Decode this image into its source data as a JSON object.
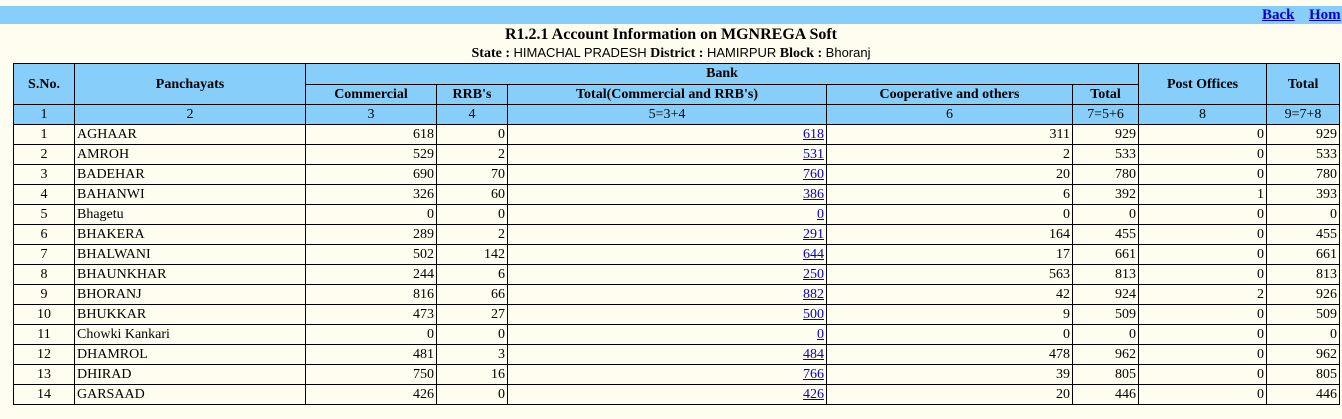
{
  "nav": {
    "back_label": "Back",
    "home_label": "Hom"
  },
  "report": {
    "title": "R1.2.1 Account Information on MGNREGA Soft",
    "state_label": "State :",
    "state_value": "HIMACHAL PRADESH",
    "district_label": "District :",
    "district_value": "HAMIRPUR",
    "block_label": "Block :",
    "block_value": "Bhoranj"
  },
  "headers": {
    "sno": "S.No.",
    "panchayats": "Panchayats",
    "bank": "Bank",
    "commercial": "Commercial",
    "rrb": "RRB's",
    "total_comm_rrb": "Total(Commercial and RRB's)",
    "cooperative": "Cooperative and others",
    "bank_total": "Total",
    "post_offices": "Post Offices",
    "total": "Total"
  },
  "column_numbers": [
    "1",
    "2",
    "3",
    "4",
    "5=3+4",
    "6",
    "7=5+6",
    "8",
    "9=7+8"
  ],
  "rows": [
    {
      "sno": "1",
      "name": "AGHAAR",
      "commercial": "618",
      "rrb": "0",
      "total_cr": "618",
      "coop": "311",
      "bank_total": "929",
      "post": "0",
      "total": "929"
    },
    {
      "sno": "2",
      "name": "AMROH",
      "commercial": "529",
      "rrb": "2",
      "total_cr": "531",
      "coop": "2",
      "bank_total": "533",
      "post": "0",
      "total": "533"
    },
    {
      "sno": "3",
      "name": "BADEHAR",
      "commercial": "690",
      "rrb": "70",
      "total_cr": "760",
      "coop": "20",
      "bank_total": "780",
      "post": "0",
      "total": "780"
    },
    {
      "sno": "4",
      "name": "BAHANWI",
      "commercial": "326",
      "rrb": "60",
      "total_cr": "386",
      "coop": "6",
      "bank_total": "392",
      "post": "1",
      "total": "393"
    },
    {
      "sno": "5",
      "name": "Bhagetu",
      "commercial": "0",
      "rrb": "0",
      "total_cr": "0",
      "coop": "0",
      "bank_total": "0",
      "post": "0",
      "total": "0"
    },
    {
      "sno": "6",
      "name": "BHAKERA",
      "commercial": "289",
      "rrb": "2",
      "total_cr": "291",
      "coop": "164",
      "bank_total": "455",
      "post": "0",
      "total": "455"
    },
    {
      "sno": "7",
      "name": "BHALWANI",
      "commercial": "502",
      "rrb": "142",
      "total_cr": "644",
      "coop": "17",
      "bank_total": "661",
      "post": "0",
      "total": "661"
    },
    {
      "sno": "8",
      "name": "BHAUNKHAR",
      "commercial": "244",
      "rrb": "6",
      "total_cr": "250",
      "coop": "563",
      "bank_total": "813",
      "post": "0",
      "total": "813"
    },
    {
      "sno": "9",
      "name": "BHORANJ",
      "commercial": "816",
      "rrb": "66",
      "total_cr": "882",
      "coop": "42",
      "bank_total": "924",
      "post": "2",
      "total": "926"
    },
    {
      "sno": "10",
      "name": "BHUKKAR",
      "commercial": "473",
      "rrb": "27",
      "total_cr": "500",
      "coop": "9",
      "bank_total": "509",
      "post": "0",
      "total": "509"
    },
    {
      "sno": "11",
      "name": "Chowki Kankari",
      "commercial": "0",
      "rrb": "0",
      "total_cr": "0",
      "coop": "0",
      "bank_total": "0",
      "post": "0",
      "total": "0"
    },
    {
      "sno": "12",
      "name": "DHAMROL",
      "commercial": "481",
      "rrb": "3",
      "total_cr": "484",
      "coop": "478",
      "bank_total": "962",
      "post": "0",
      "total": "962"
    },
    {
      "sno": "13",
      "name": "DHIRAD",
      "commercial": "750",
      "rrb": "16",
      "total_cr": "766",
      "coop": "39",
      "bank_total": "805",
      "post": "0",
      "total": "805"
    },
    {
      "sno": "14",
      "name": "GARSAAD",
      "commercial": "426",
      "rrb": "0",
      "total_cr": "426",
      "coop": "20",
      "bank_total": "446",
      "post": "0",
      "total": "446"
    }
  ],
  "colors": {
    "header_bg": "#87cefa",
    "page_bg": "#fffdf0",
    "link": "#0000cc"
  }
}
